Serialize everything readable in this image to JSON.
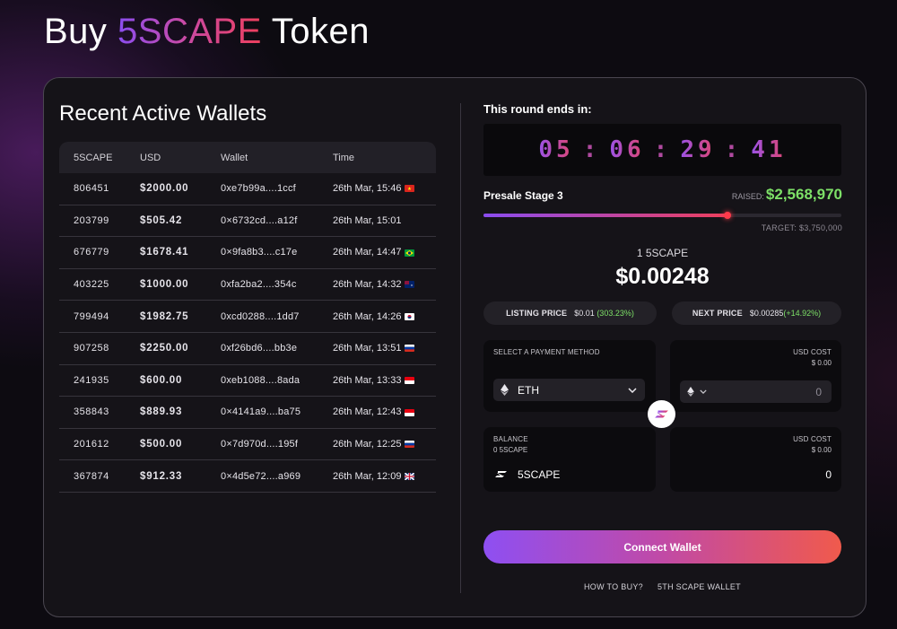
{
  "page": {
    "title_prefix": "Buy ",
    "title_brand": "5SCAPE",
    "title_suffix": " Token"
  },
  "wallets": {
    "title": "Recent Active Wallets",
    "columns": [
      "5SCAPE",
      "USD",
      "Wallet",
      "Time"
    ],
    "rows": [
      {
        "tokens": "806451",
        "usd": "$2000.00",
        "wallet": "0xe7b99a....1ccf",
        "time": "26th Mar, 15:46",
        "flag": "vietnam-flag-icon"
      },
      {
        "tokens": "203799",
        "usd": "$505.42",
        "wallet": "0×6732cd....a12f",
        "time": "26th Mar, 15:01",
        "flag": ""
      },
      {
        "tokens": "676779",
        "usd": "$1678.41",
        "wallet": "0×9fa8b3....c17e",
        "time": "26th Mar, 14:47",
        "flag": "brazil-flag-icon"
      },
      {
        "tokens": "403225",
        "usd": "$1000.00",
        "wallet": "0xfa2ba2....354c",
        "time": "26th Mar, 14:32",
        "flag": "australia-flag-icon"
      },
      {
        "tokens": "799494",
        "usd": "$1982.75",
        "wallet": "0xcd0288....1dd7",
        "time": "26th Mar, 14:26",
        "flag": "south-korea-flag-icon"
      },
      {
        "tokens": "907258",
        "usd": "$2250.00",
        "wallet": "0xf26bd6....bb3e",
        "time": "26th Mar, 13:51",
        "flag": "russia-flag-icon"
      },
      {
        "tokens": "241935",
        "usd": "$600.00",
        "wallet": "0xeb1088....8ada",
        "time": "26th Mar, 13:33",
        "flag": "indonesia-flag-icon"
      },
      {
        "tokens": "358843",
        "usd": "$889.93",
        "wallet": "0×4141a9....ba75",
        "time": "26th Mar, 12:43",
        "flag": "indonesia-flag-icon"
      },
      {
        "tokens": "201612",
        "usd": "$500.00",
        "wallet": "0×7d970d....195f",
        "time": "26th Mar, 12:25",
        "flag": "russia-flag-icon"
      },
      {
        "tokens": "367874",
        "usd": "$912.33",
        "wallet": "0×4d5e72....a969",
        "time": "26th Mar, 12:09",
        "flag": "uk-flag-icon"
      }
    ]
  },
  "presale": {
    "round_label": "This round ends in:",
    "countdown": [
      "05",
      "06",
      "29",
      "41"
    ],
    "countdown_sep": ":",
    "stage": "Presale Stage 3",
    "raised_label": "RAISED:",
    "raised_amount": "$2,568,970",
    "target": "TARGET: $3,750,000",
    "progress_fraction": 0.685,
    "unit_label": "1 5SCAPE",
    "price": "$0.00248",
    "listing_label": "LISTING PRICE",
    "listing_value": "$0.01",
    "listing_change": "(303.23%)",
    "next_label": "NEXT PRICE",
    "next_value": "$0.00285",
    "next_change": "(+14.92%)"
  },
  "pay": {
    "method_label": "SELECT A PAYMENT METHOD",
    "currency": "ETH",
    "usd_cost_label": "USD COST",
    "usd_cost_value": "$ 0.00",
    "amount_value": "0",
    "balance_label": "BALANCE",
    "balance_value": "0 5SCAPE",
    "receive_token": "5SCAPE",
    "receive_usd_label": "USD COST",
    "receive_usd_value": "$ 0.00",
    "receive_amount": "0"
  },
  "actions": {
    "connect_label": "Connect Wallet",
    "how_to_buy": "HOW TO BUY?",
    "wallet_link": "5TH SCAPE WALLET"
  },
  "colors": {
    "accent_purple": "#8b4df0",
    "accent_red": "#ee3f5c",
    "positive_green": "#7de067"
  }
}
